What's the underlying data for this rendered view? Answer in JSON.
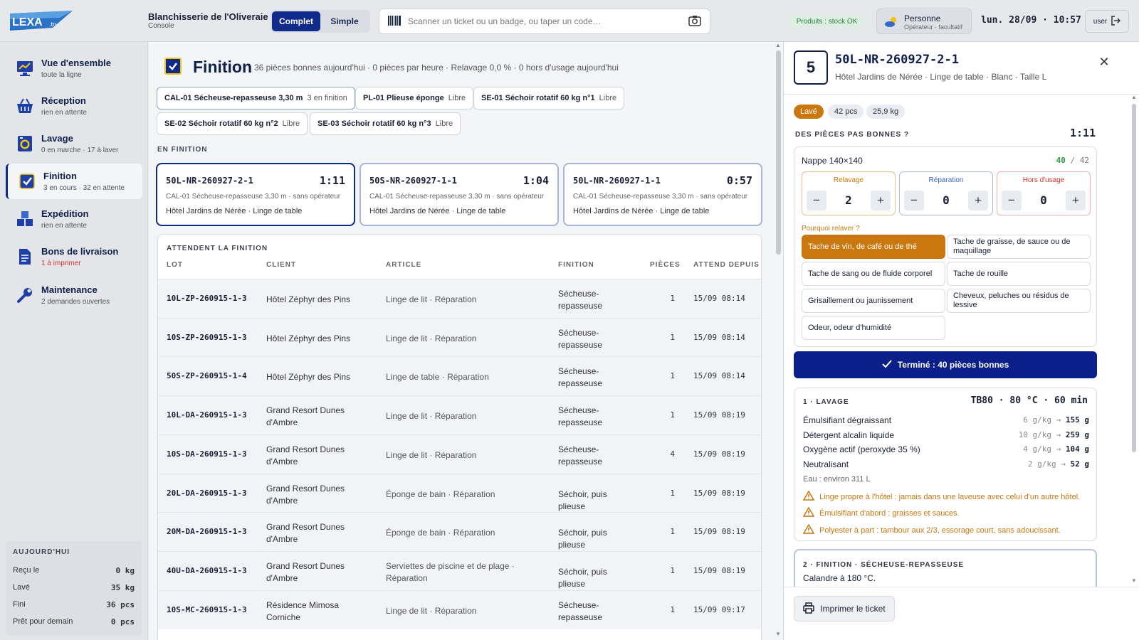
{
  "header": {
    "logo_text": "LEXA",
    "logo_suffix": ".tn",
    "brand_name": "Blanchisserie de l'Oliveraie",
    "brand_sub": "Console",
    "modes": [
      "Complet",
      "Simple"
    ],
    "scan_placeholder": "Scanner un ticket ou un badge, ou taper un code…",
    "stock_badge": "Produits : stock OK",
    "person_name": "Personne",
    "person_role": "Opérateur · facultatif",
    "datetime": "lun. 28/09 · 10:57",
    "user_label": "user"
  },
  "sidebar": {
    "items": [
      {
        "label": "Vue d'ensemble",
        "sub": "toute la ligne",
        "icon": "monitor-chart-icon"
      },
      {
        "label": "Réception",
        "sub": "rien en attente",
        "icon": "basket-icon"
      },
      {
        "label": "Lavage",
        "sub": "0 en marche · 17 à laver",
        "icon": "washing-machine-icon"
      },
      {
        "label": "Finition",
        "sub": "3 en cours · 32 en attente",
        "icon": "checkbox-icon"
      },
      {
        "label": "Expédition",
        "sub": "rien en attente",
        "icon": "boxes-icon"
      },
      {
        "label": "Bons de livraison",
        "sub": "1 à imprimer",
        "icon": "document-icon"
      },
      {
        "label": "Maintenance",
        "sub": "2 demandes ouvertes",
        "icon": "wrench-icon"
      }
    ],
    "today": {
      "title": "AUJOURD'HUI",
      "rows": [
        {
          "label": "Reçu le",
          "value": "0 kg"
        },
        {
          "label": "Lavé",
          "value": "35 kg"
        },
        {
          "label": "Fini",
          "value": "36 pcs"
        },
        {
          "label": "Prêt pour demain",
          "value": "0 pcs"
        }
      ]
    }
  },
  "main": {
    "title": "Finition",
    "stats": "36 pièces bonnes aujourd'hui · 0 pièces par heure · Relavage 0,0 % · 0 hors d'usage aujourd'hui",
    "machines": [
      {
        "name": "CAL-01 Sécheuse-repasseuse 3,30 m",
        "status": "3 en finition"
      },
      {
        "name": "PL-01 Plieuse éponge",
        "status": "Libre"
      },
      {
        "name": "SE-01 Séchoir rotatif 60 kg n°1",
        "status": "Libre"
      },
      {
        "name": "SE-02 Séchoir rotatif 60 kg n°2",
        "status": "Libre"
      },
      {
        "name": "SE-03 Séchoir rotatif 60 kg n°3",
        "status": "Libre"
      }
    ],
    "in_progress_label": "EN FINITION",
    "in_progress": [
      {
        "lot": "50L-NR-260927-2-1",
        "time": "1:11",
        "machine": "CAL-01 Sécheuse-repasseuse 3,30 m · sans opérateur",
        "client": "Hôtel Jardins de Nérée · Linge de table"
      },
      {
        "lot": "50S-NR-260927-1-1",
        "time": "1:04",
        "machine": "CAL-01 Sécheuse-repasseuse 3,30 m · sans opérateur",
        "client": "Hôtel Jardins de Nérée · Linge de table"
      },
      {
        "lot": "50L-NR-260927-1-1",
        "time": "0:57",
        "machine": "CAL-01 Sécheuse-repasseuse 3,30 m · sans opérateur",
        "client": "Hôtel Jardins de Nérée · Linge de table"
      }
    ],
    "waiting_label": "ATTENDENT LA FINITION",
    "columns": [
      "LOT",
      "CLIENT",
      "ARTICLE",
      "FINITION",
      "PIÈCES",
      "ATTEND DEPUIS"
    ],
    "rows": [
      {
        "lot": "10L-ZP-260915-1-3",
        "client": "Hôtel Zéphyr des Pins",
        "article": "Linge de lit · Réparation",
        "finition": "Sécheuse-repasseuse",
        "pieces": "1",
        "since": "15/09 08:14"
      },
      {
        "lot": "10S-ZP-260915-1-3",
        "client": "Hôtel Zéphyr des Pins",
        "article": "Linge de lit · Réparation",
        "finition": "Sécheuse-repasseuse",
        "pieces": "1",
        "since": "15/09 08:14"
      },
      {
        "lot": "50S-ZP-260915-1-4",
        "client": "Hôtel Zéphyr des Pins",
        "article": "Linge de table · Réparation",
        "finition": "Sécheuse-repasseuse",
        "pieces": "1",
        "since": "15/09 08:14"
      },
      {
        "lot": "10L-DA-260915-1-3",
        "client": "Grand Resort Dunes d'Ambre",
        "article": "Linge de lit · Réparation",
        "finition": "Sécheuse-repasseuse",
        "pieces": "1",
        "since": "15/09 08:19"
      },
      {
        "lot": "10S-DA-260915-1-3",
        "client": "Grand Resort Dunes d'Ambre",
        "article": "Linge de lit · Réparation",
        "finition": "Sécheuse-repasseuse",
        "pieces": "4",
        "since": "15/09 08:19"
      },
      {
        "lot": "20L-DA-260915-1-3",
        "client": "Grand Resort Dunes d'Ambre",
        "article": "Éponge de bain · Réparation",
        "finition": "Séchoir, puis plieuse",
        "pieces": "1",
        "since": "15/09 08:19"
      },
      {
        "lot": "20M-DA-260915-1-3",
        "client": "Grand Resort Dunes d'Ambre",
        "article": "Éponge de bain · Réparation",
        "finition": "Séchoir, puis plieuse",
        "pieces": "1",
        "since": "15/09 08:19"
      },
      {
        "lot": "40U-DA-260915-1-3",
        "client": "Grand Resort Dunes d'Ambre",
        "article": "Serviettes de piscine et de plage · Réparation",
        "finition": "Séchoir, puis plieuse",
        "pieces": "1",
        "since": "15/09 08:19"
      },
      {
        "lot": "10S-MC-260915-1-3",
        "client": "Résidence Mimosa Corniche",
        "article": "Linge de lit · Réparation",
        "finition": "Sécheuse-repasseuse",
        "pieces": "1",
        "since": "15/09 09:17"
      }
    ]
  },
  "detail": {
    "number": "5",
    "lot": "50L-NR-260927-2-1",
    "subtitle": "Hôtel Jardins de Nérée · Linge de table · Blanc · Taille L",
    "chips": [
      "Lavé",
      "42 pcs",
      "25,9 kg"
    ],
    "question": "DES PIÈCES PAS BONNES ?",
    "timer": "1:11",
    "item": "Nappe 140×140",
    "good": "40",
    "total": "/ 42",
    "steppers": [
      {
        "label": "Relavage",
        "value": "2",
        "color": "#c9770e"
      },
      {
        "label": "Réparation",
        "value": "0",
        "color": "#3a68c8"
      },
      {
        "label": "Hors d'usage",
        "value": "0",
        "color": "#d2342a"
      }
    ],
    "why_label": "Pourquoi relaver ?",
    "reasons": [
      "Tache de vin, de café ou de thé",
      "Tache de graisse, de sauce ou de maquillage",
      "Tache de sang ou de fluide corporel",
      "Tache de rouille",
      "Grisaillement ou jaunissement",
      "Cheveux, peluches ou résidus de lessive",
      "Odeur, odeur d'humidité"
    ],
    "done_label": "Terminé : 40 pièces bonnes",
    "wash": {
      "title": "1 · LAVAGE",
      "program": "TB80 · 80 °C · 60 min",
      "chemicals": [
        {
          "name": "Émulsifiant dégraissant",
          "rate": "6 g/kg →",
          "amount": "155 g"
        },
        {
          "name": "Détergent alcalin liquide",
          "rate": "10 g/kg →",
          "amount": "259 g"
        },
        {
          "name": "Oxygène actif (peroxyde 35 %)",
          "rate": "4 g/kg →",
          "amount": "104 g"
        },
        {
          "name": "Neutralisant",
          "rate": "2 g/kg →",
          "amount": "52 g"
        }
      ],
      "water": "Eau : environ 311 L",
      "warnings": [
        "Linge propre à l'hôtel : jamais dans une laveuse avec celui d'un autre hôtel.",
        "Émulsifiant d'abord : graisses et sauces.",
        "Polyester à part : tambour aux 2/3, essorage court, sans adoucissant."
      ]
    },
    "finish": {
      "title": "2 · FINITION · SÉCHEUSE-REPASSEUSE",
      "text": "Calandre à 180 °C."
    },
    "print_label": "Imprimer le ticket"
  },
  "colors": {
    "accent": "#0f2a8a",
    "warning": "#c9770e",
    "ok": "#2a8040",
    "danger": "#d2342a"
  }
}
